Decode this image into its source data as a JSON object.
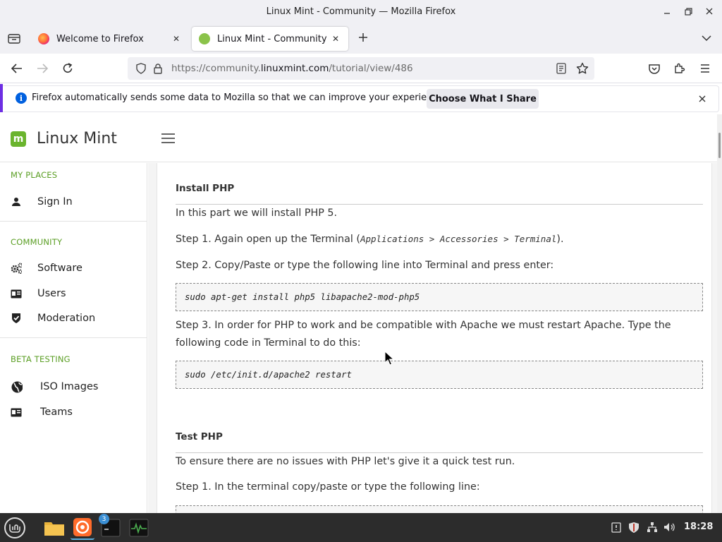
{
  "window": {
    "title": "Linux Mint - Community — Mozilla Firefox"
  },
  "tabs": [
    {
      "label": "Welcome to Firefox",
      "active": false
    },
    {
      "label": "Linux Mint - Community",
      "active": true
    }
  ],
  "urlbar": {
    "url_prefix": "https://community.",
    "url_domain": "linuxmint.com",
    "url_path": "/tutorial/view/486"
  },
  "notification": {
    "text": "Firefox automatically sends some data to Mozilla so that we can improve your experience.",
    "button_label": "Choose What I Share"
  },
  "site": {
    "title": "Linux Mint",
    "logo_letter": "m"
  },
  "sidebar": {
    "sections": [
      {
        "heading": "MY PLACES",
        "items": [
          {
            "label": "Sign In",
            "icon": "user-icon"
          }
        ]
      },
      {
        "heading": "COMMUNITY",
        "items": [
          {
            "label": "Software",
            "icon": "gears-icon"
          },
          {
            "label": "Users",
            "icon": "id-card-icon"
          },
          {
            "label": "Moderation",
            "icon": "shield-check-icon"
          }
        ]
      },
      {
        "heading": "BETA TESTING",
        "items": [
          {
            "label": "ISO Images",
            "icon": "globe-icon"
          },
          {
            "label": "Teams",
            "icon": "id-card-icon"
          }
        ]
      }
    ]
  },
  "article": {
    "section1_heading": "Install PHP",
    "p1": "In this part we will install PHP 5.",
    "p2_prefix": "Step 1. Again open up the Terminal (",
    "p2_code": "Applications > Accessories > Terminal",
    "p2_suffix": ").",
    "p3": "Step 2. Copy/Paste or type the following line into Terminal and press enter:",
    "code1": "sudo apt-get install php5 libapache2-mod-php5",
    "p4": "Step 3. In order for PHP to work and be compatible with Apache we must restart Apache. Type the following code in Terminal to do this:",
    "code2": "sudo /etc/init.d/apache2 restart",
    "section2_heading": "Test PHP",
    "p5": "To ensure there are no issues with PHP let's give it a quick test run.",
    "p6": "Step 1. In the terminal copy/paste or type the following line:"
  },
  "taskbar": {
    "terminal_badge": "3",
    "clock": "18:28"
  },
  "colors": {
    "accent_green": "#6ab42d",
    "notification_border": "#6d2ee3",
    "info_blue": "#0060df"
  }
}
